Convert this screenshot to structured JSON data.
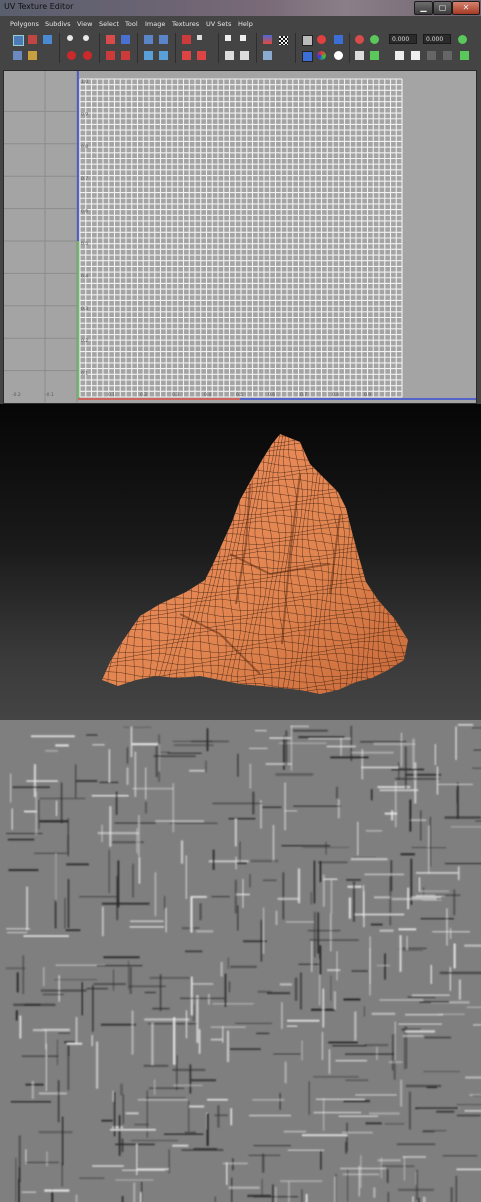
{
  "window": {
    "title": "UV Texture Editor",
    "controls": {
      "minimize": "▁",
      "maximize": "▢",
      "close": "✕"
    }
  },
  "menu": [
    "Polygons",
    "Subdivs",
    "View",
    "Select",
    "Tool",
    "Image",
    "Textures",
    "UV Sets",
    "Help"
  ],
  "toolbar": {
    "field_u": "0.000",
    "field_v": "0.000",
    "icons": [
      "select-uv-icon",
      "move-uv-icon",
      "rotate-uv-icon",
      "flip-u-icon",
      "flip-v-icon",
      "cut-uv-icon",
      "sew-uv-icon",
      "unfold-icon",
      "layout-icon",
      "grid-icon",
      "snap-icon",
      "image-icon",
      "checker-icon",
      "shaded-icon",
      "color-channel-icon",
      "texture-filter-icon",
      "isolate-icon",
      "pin-icon"
    ]
  },
  "uv_grid": {
    "rulers_v": [
      "1.0",
      "0.9",
      "0.8",
      "0.7",
      "0.6",
      "0.5",
      "0.4",
      "0.3",
      "0.2",
      "0.1"
    ],
    "rulers_u": [
      "-0.2",
      "-0.1",
      "0.1",
      "0.2",
      "0.3",
      "0.4",
      "0.5",
      "0.6",
      "0.7",
      "0.8",
      "0.9"
    ]
  },
  "colors": {
    "editor_bg": "#444444",
    "viewport_bg": "#a4a4a4",
    "uv_wire": "#f2f2f2",
    "u_axis": "#d8504a",
    "v_axis": "#5fc45b",
    "border_axis": "#3b4fd8",
    "mesh_fill": "#e0844f",
    "mesh_wire": "#2a1408",
    "map_gray": "#7f7f7f"
  }
}
